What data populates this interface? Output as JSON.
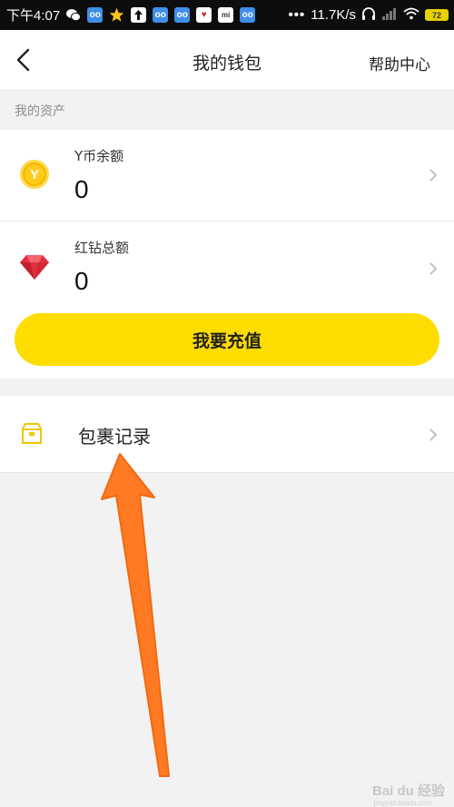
{
  "status_bar": {
    "time": "下午4:07",
    "network_speed": "11.7K/s",
    "battery_level": "72",
    "overflow_dots": "•••"
  },
  "nav": {
    "title": "我的钱包",
    "help": "帮助中心"
  },
  "assets": {
    "section_label": "我的资产",
    "coin": {
      "label": "Y币余额",
      "value": "0",
      "icon_letter": "Y"
    },
    "diamond": {
      "label": "红钻总额",
      "value": "0"
    }
  },
  "recharge": {
    "label": "我要充值"
  },
  "package": {
    "label": "包裹记录"
  },
  "colors": {
    "accent_yellow": "#ffdd00",
    "annotation_arrow": "#ff7a22",
    "diamond_red": "#e0303f"
  },
  "watermark": {
    "brand": "Bai du 经验",
    "url": "jingyan.baidu.com"
  }
}
